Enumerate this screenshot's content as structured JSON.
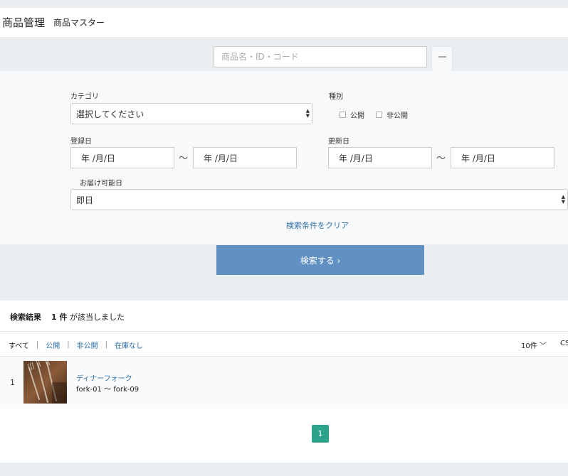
{
  "header": {
    "title": "商品管理",
    "subtitle": "商品マスター"
  },
  "search": {
    "placeholder": "商品名・ID・コード",
    "value": ""
  },
  "filters": {
    "category": {
      "label": "カテゴリ",
      "selected": "選択してください"
    },
    "type": {
      "label": "種別",
      "options": [
        {
          "label": "公開",
          "checked": false
        },
        {
          "label": "非公開",
          "checked": false
        }
      ]
    },
    "registered": {
      "label": "登録日",
      "from": "年 /月/日",
      "to": "年 /月/日",
      "separator": "〜"
    },
    "updated": {
      "label": "更新日",
      "from": "年 /月/日",
      "to": "年 /月/日",
      "separator": "〜"
    },
    "delivery": {
      "label": "お届け可能日",
      "selected": "即日"
    },
    "clear_label": "検索条件をクリア"
  },
  "search_button": {
    "label": "検索する ›"
  },
  "results": {
    "heading_label": "検索結果",
    "count_text": "1 件",
    "suffix": "が該当しました",
    "tabs": [
      {
        "label": "すべて"
      },
      {
        "label": "公開"
      },
      {
        "label": "非公開"
      },
      {
        "label": "在庫なし"
      }
    ],
    "per_page": "10件 ﹀",
    "csv_label": "CSV",
    "rows": [
      {
        "index": "1",
        "name": "ディナーフォーク",
        "code": "fork-01 〜 fork-09"
      }
    ],
    "pagination": {
      "current": "1"
    }
  },
  "colors": {
    "accent": "#6190c2",
    "link": "#2d6fa6",
    "pager": "#2aa38a"
  }
}
